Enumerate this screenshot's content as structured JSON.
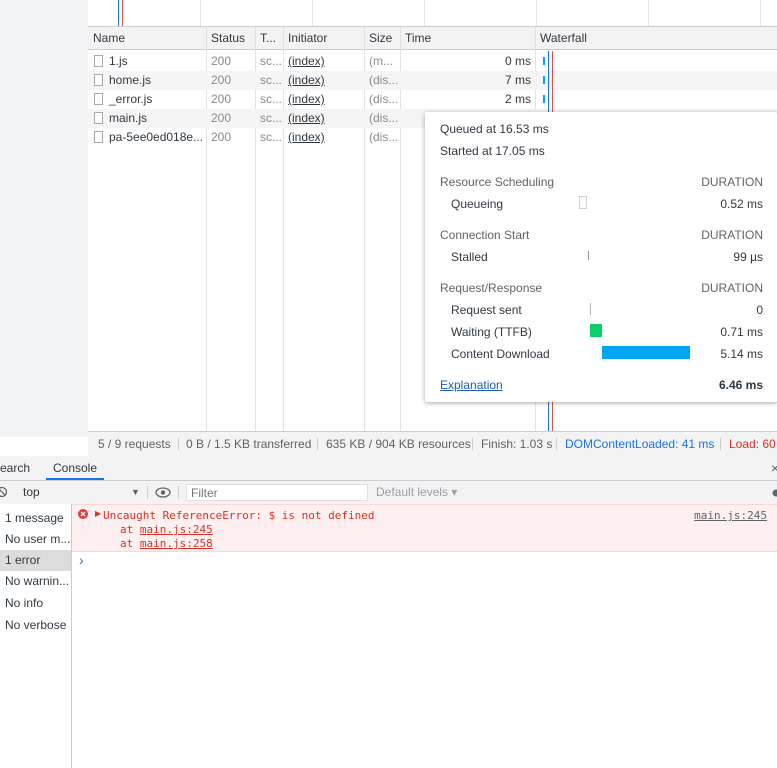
{
  "network": {
    "columns": {
      "name": "Name",
      "status": "Status",
      "type": "T...",
      "initiator": "Initiator",
      "size": "Size",
      "time": "Time",
      "waterfall": "Waterfall"
    },
    "rows": [
      {
        "name": "1.js",
        "status": "200",
        "type": "sc...",
        "initiator": "(index)",
        "size": "(m...",
        "time": "0 ms"
      },
      {
        "name": "home.js",
        "status": "200",
        "type": "sc...",
        "initiator": "(index)",
        "size": "(dis...",
        "time": "7 ms"
      },
      {
        "name": "_error.js",
        "status": "200",
        "type": "sc...",
        "initiator": "(index)",
        "size": "(dis...",
        "time": "2 ms"
      },
      {
        "name": "main.js",
        "status": "200",
        "type": "sc...",
        "initiator": "(index)",
        "size": "(dis...",
        "time": ""
      },
      {
        "name": "pa-5ee0ed018e...",
        "status": "200",
        "type": "sc...",
        "initiator": "(index)",
        "size": "(dis...",
        "time": ""
      }
    ]
  },
  "status_bar": {
    "requests": "5 / 9 requests",
    "transferred": "0 B / 1.5 KB transferred",
    "resources": "635 KB / 904 KB resources",
    "finish": "Finish: 1.03 s",
    "dom_content_loaded": "DOMContentLoaded: 41 ms",
    "load": "Load: 60"
  },
  "timing": {
    "queued": "Queued at 16.53 ms",
    "started": "Started at 17.05 ms",
    "duration_label": "DURATION",
    "resource_scheduling": "Resource Scheduling",
    "queueing_label": "Queueing",
    "queueing_value": "0.52 ms",
    "connection_start": "Connection Start",
    "stalled_label": "Stalled",
    "stalled_value": "99 µs",
    "request_response": "Request/Response",
    "request_sent_label": "Request sent",
    "request_sent_value": "0",
    "waiting_label": "Waiting (TTFB)",
    "waiting_value": "0.71 ms",
    "download_label": "Content Download",
    "download_value": "5.14 ms",
    "explanation": "Explanation",
    "total": "6.46 ms",
    "colors": {
      "waiting": "#0cce6b",
      "download": "#00a6f5"
    }
  },
  "drawer": {
    "tab_search": "earch",
    "tab_console": "Console",
    "close_glyph": "×"
  },
  "console_toolbar": {
    "context": "top",
    "filter_placeholder": "Filter",
    "levels": "Default levels ▾"
  },
  "sidebar": {
    "items": [
      "1 message",
      "No user m...",
      "1 error",
      "No warnin...",
      "No info",
      "No verbose"
    ]
  },
  "console": {
    "error_message": "Uncaught ReferenceError: $ is not defined",
    "stack_prefix": "at ",
    "stack": [
      "main.js:245",
      "main.js:258"
    ],
    "source": "main.js:245",
    "prompt": "›"
  }
}
